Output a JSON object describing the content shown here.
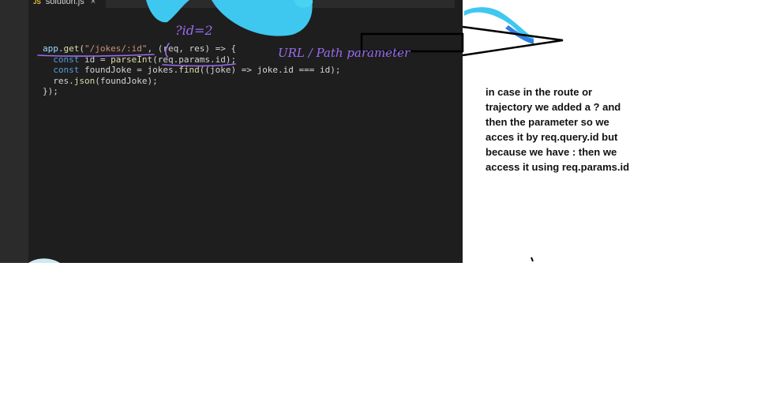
{
  "editor": {
    "tab": {
      "badge": "JS",
      "filename": "solution.js",
      "close_glyph": "×"
    },
    "code_lines": [
      [
        {
          "t": "app.",
          "c": "tok-var"
        },
        {
          "t": "get",
          "c": "tok-fn"
        },
        {
          "t": "(",
          "c": ""
        },
        {
          "t": "\"/jokes/:id\"",
          "c": "tok-str"
        },
        {
          "t": ", (req, res) => {",
          "c": ""
        }
      ],
      [
        {
          "t": "  ",
          "c": ""
        },
        {
          "t": "const",
          "c": "tok-kw"
        },
        {
          "t": " id = ",
          "c": ""
        },
        {
          "t": "parseInt",
          "c": "tok-fn"
        },
        {
          "t": "(req.params.id);",
          "c": ""
        }
      ],
      [
        {
          "t": "  ",
          "c": ""
        },
        {
          "t": "const",
          "c": "tok-kw"
        },
        {
          "t": " foundJoke = jokes.",
          "c": ""
        },
        {
          "t": "find",
          "c": "tok-fn"
        },
        {
          "t": "((joke) => joke.id === id);",
          "c": ""
        }
      ],
      [
        {
          "t": "  res.",
          "c": ""
        },
        {
          "t": "json",
          "c": "tok-fn"
        },
        {
          "t": "(foundJoke);",
          "c": ""
        }
      ],
      [
        {
          "t": "});",
          "c": ""
        }
      ]
    ]
  },
  "handwriting": {
    "query_note": "?id=2",
    "param_note": "URL / Path parameter"
  },
  "annotation": {
    "text": "in case in the route or trajectory we added a ? and then the parameter so we acces it by req.query.id but because we have : then we access it using req.params.id"
  },
  "colors": {
    "editor_bg": "#1e1e1e",
    "sidebar_bg": "#2b2b2b",
    "handwriting": "#9b6cf0",
    "splash_blue": "#3ec8f0",
    "annotation_text": "#111111"
  }
}
